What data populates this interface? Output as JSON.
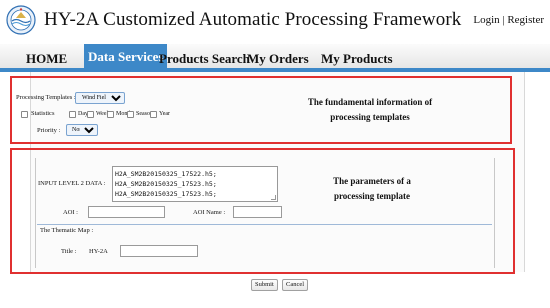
{
  "header": {
    "title": "HY-2A Customized Automatic Processing Framework",
    "login": "Login",
    "separator": "|",
    "register": "Register"
  },
  "nav": {
    "items": [
      {
        "label": "HOME",
        "active": false
      },
      {
        "label": "Data Services",
        "active": true
      },
      {
        "label": "Products Search",
        "active": false
      },
      {
        "label": "My Orders",
        "active": false
      },
      {
        "label": "My Products",
        "active": false
      }
    ],
    "accent_color": "#3d88c8"
  },
  "template_section": {
    "processing_templates_label": "Processing Templates :",
    "template_selected": "Wind Field",
    "statistics_label": "Statistics",
    "statistics_options": [
      "Day",
      "Week",
      "Month",
      "Season",
      "Year"
    ],
    "priority_label": "Priority :",
    "priority_selected": "Normal",
    "annotation": "The fundamental information of processing templates"
  },
  "parameters_section": {
    "input_label": "INPUT LEVEL 2 DATA :",
    "input_files": [
      "H2A_SM2B20150325_17522.h5;",
      "H2A_SM2B20150325_17523.h5;",
      "H2A_SM2B20150325_17523.h5;"
    ],
    "aoi_label": "AOI :",
    "aoi_value": "",
    "aoi_name_label": "AOI Name :",
    "aoi_name_value": "",
    "thematic_map_label": "The Thematic Map :",
    "title_label": "Title :",
    "title_prefix": "HY-2A",
    "title_value": "",
    "annotation": "The parameters of a processing template"
  },
  "actions": {
    "submit": "Submit",
    "cancel": "Cancel"
  },
  "colors": {
    "highlight_box": "#e03030",
    "nav_accent": "#3d88c8"
  }
}
